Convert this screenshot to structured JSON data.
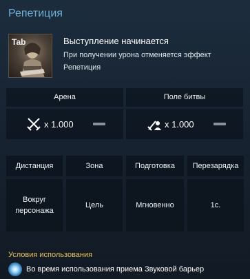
{
  "title": "Репетиция",
  "skill": {
    "hotkey": "Tab",
    "name": "Выступление начинается",
    "description": "При получении урона отменяется эффект Репетиция"
  },
  "modes": {
    "arena": {
      "label": "Арена",
      "multiplier": "x 1.000",
      "icon": "crossed-swords-icon"
    },
    "battlefield": {
      "label": "Поле битвы",
      "multiplier": "x 1.000",
      "icon": "sword-person-icon"
    }
  },
  "stats": [
    {
      "label": "Дистанция",
      "value": "Вокруг персонажа"
    },
    {
      "label": "Зона",
      "value": "Цель"
    },
    {
      "label": "Подготовка",
      "value": "Мгновенно"
    },
    {
      "label": "Перезарядка",
      "value": "1с."
    }
  ],
  "conditions": {
    "title": "Условия использования",
    "item": "Во время использования приема Звуковой барьер"
  },
  "colors": {
    "title": "#6fb1d6",
    "condition_title": "#e6c35c"
  }
}
